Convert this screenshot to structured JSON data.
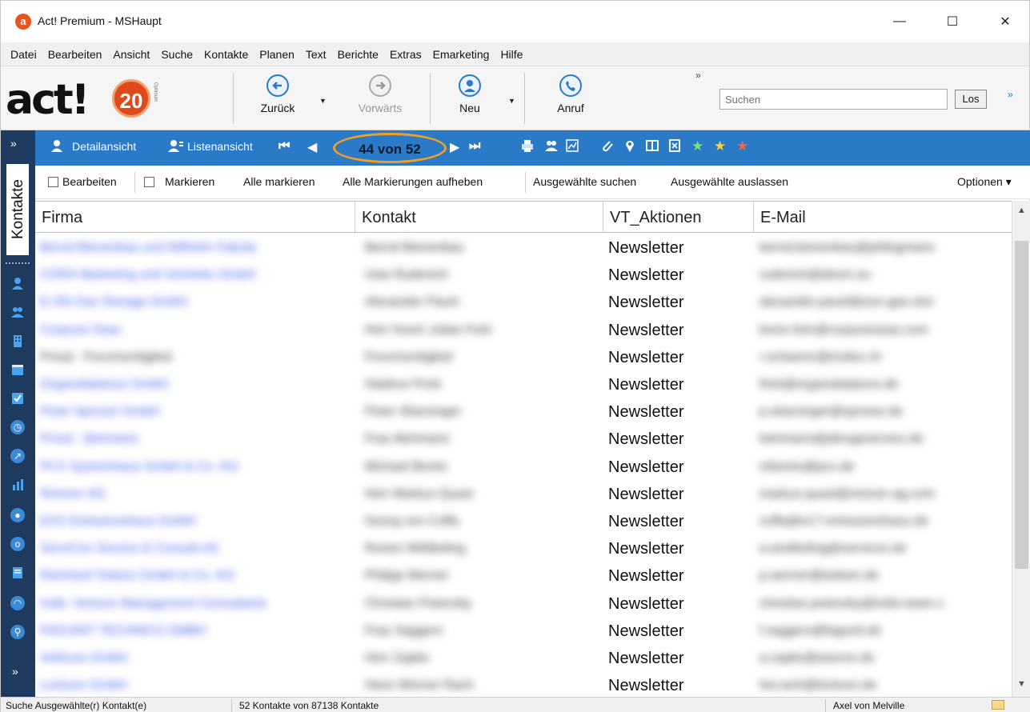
{
  "window": {
    "title": "Act! Premium - MSHaupt",
    "app_icon_letter": "a",
    "controls": {
      "minimize": "—",
      "maximize": "☐",
      "close": "✕"
    }
  },
  "menu": [
    "Datei",
    "Bearbeiten",
    "Ansicht",
    "Suche",
    "Kontakte",
    "Planen",
    "Text",
    "Berichte",
    "Extras",
    "Emarketing",
    "Hilfe"
  ],
  "toolbar": {
    "logo_text": "act!",
    "logo_badge": "20",
    "logo_sub": "Optimum",
    "buttons": {
      "back": "Zurück",
      "forward": "Vorwärts",
      "new": "Neu",
      "call": "Anruf"
    },
    "search_placeholder": "Suchen",
    "search_button": "Los",
    "overflow": "»",
    "more": "»"
  },
  "sidebar": {
    "active_tab": "Kontakte",
    "top_chevron": "»",
    "bottom_chevron": "»",
    "icons": [
      "contact-icon",
      "group-icon",
      "company-icon",
      "calendar-icon",
      "task-icon",
      "opportunity-icon",
      "dashboard-icon",
      "report-icon",
      "info-icon",
      "outlook-icon",
      "document-icon",
      "gauge-icon",
      "search-icon"
    ]
  },
  "viewbar": {
    "detail_view": "Detailansicht",
    "list_view": "Listenansicht",
    "record_counter": "44 von 52",
    "first": "⏮",
    "prev": "◀",
    "next": "▶",
    "last": "⏭"
  },
  "actionbar": {
    "edit": "Bearbeiten",
    "mark": "Markieren",
    "mark_all": "Alle markieren",
    "unmark_all": "Alle Markierungen aufheben",
    "find_selected": "Ausgewählte suchen",
    "omit_selected": "Ausgewählte auslassen",
    "options": "Optionen"
  },
  "grid": {
    "columns": [
      "Firma",
      "Kontakt",
      "VT_Aktionen",
      "E-Mail"
    ],
    "rows": [
      {
        "firma": "Bernd Bienenbau und Wilhelm Fabula",
        "kontakt": "Bernd Bienenbau",
        "aktion": "Newsletter",
        "email": "bernd.bienenbau@philegmann"
      },
      {
        "firma": "CORA Marketing und Vertriebs GmbH",
        "kontakt": "Uwe Rudenich",
        "aktion": "Newsletter",
        "email": "rudenich@desm.eu"
      },
      {
        "firma": "E.ON Gas Storage GmbH",
        "kontakt": "Alexander Pavel",
        "aktion": "Newsletter",
        "email": "alexander.pavel@eon-gas-stor"
      },
      {
        "firma": "Corpuse Seas",
        "kontakt": "Herr Kevin Julian Fuhr",
        "aktion": "Newsletter",
        "email": "kevin.fuhr@corpuseseas.com"
      },
      {
        "firma": "Privat - Forumsmitglied",
        "kontakt": "Forumsmitglied",
        "aktion": "Newsletter",
        "email": "r.schaerer@endex.ch",
        "plain": true
      },
      {
        "firma": "Organobalance GmbH",
        "kontakt": "Haidrun Frick",
        "aktion": "Newsletter",
        "email": "frick@organobalance.de"
      },
      {
        "firma": "Peter Sproser GmbH",
        "kontakt": "Peter Sbarzinger",
        "aktion": "Newsletter",
        "email": "p.sbarzinger@sproser.de"
      },
      {
        "firma": "Privat - Behmann",
        "kontakt": "Frau Behmann",
        "aktion": "Newsletter",
        "email": "behmann@pfengeservice.de"
      },
      {
        "firma": "PCX Systemhaus GmbH & Co. KG",
        "kontakt": "Michael Becks",
        "aktion": "Newsletter",
        "email": "mbecks@pcx.de"
      },
      {
        "firma": "Reisner AG",
        "kontakt": "Herr Markus Quast",
        "aktion": "Newsletter",
        "email": "markus.quast@reisner-ag.com"
      },
      {
        "firma": "EXX Emissionshaus GmbH",
        "kontakt": "Georg von Coffa",
        "aktion": "Newsletter",
        "email": "coffa@e17-emissionshaus.de"
      },
      {
        "firma": "ServiCon Service & Consult eG",
        "kontakt": "Ronen Wildbeling",
        "aktion": "Newsletter",
        "email": "a.wodbeling@servicon.de"
      },
      {
        "firma": "Reinhard Tedsen GmbH & Co. KG",
        "kontakt": "Philipp Werner",
        "aktion": "Newsletter",
        "email": "p.werner@tedsen.de"
      },
      {
        "firma": "Indiv. Venture Management Consultants",
        "kontakt": "Christian Potensky",
        "aktion": "Newsletter",
        "email": "christian.potensky@indiv-team.c"
      },
      {
        "firma": "FAGUNIT TECHNICS GMBH",
        "kontakt": "Frau Saggers",
        "aktion": "Newsletter",
        "email": "f.saggers@fagunit.de"
      },
      {
        "firma": "Arbhuss GmbH",
        "kontakt": "Herr Zapke",
        "aktion": "Newsletter",
        "email": "a.zapke@aseron.de"
      },
      {
        "firma": "Lontuon GmbH",
        "kontakt": "Hans Werner Rach",
        "aktion": "Newsletter",
        "email": "hw.rach@lontuon.de"
      }
    ]
  },
  "statusbar": {
    "left": "Suche Ausgewählte(r) Kontakt(e)",
    "count": "52 Kontakte von 87138 Kontakte",
    "user": "Axel von Melville"
  },
  "colors": {
    "accent_blue": "#2a7ac8",
    "sidebar_navy": "#1f3a5f",
    "highlight_orange": "#f0a020",
    "link_blue": "#3b55e6"
  }
}
